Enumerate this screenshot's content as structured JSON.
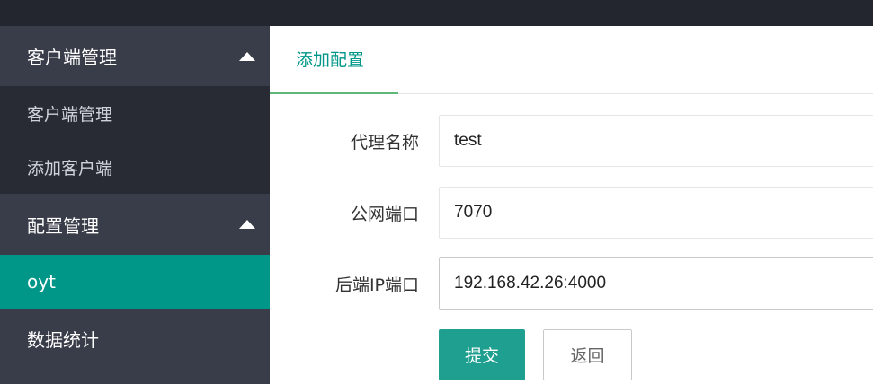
{
  "sidebar": {
    "groups": [
      {
        "label": "客户端管理",
        "expanded": true,
        "items": [
          {
            "label": "客户端管理"
          },
          {
            "label": "添加客户端"
          }
        ]
      },
      {
        "label": "配置管理",
        "expanded": true,
        "items": [
          {
            "label": "oyt",
            "active": true
          }
        ]
      },
      {
        "label": "数据统计"
      }
    ]
  },
  "main": {
    "tab": {
      "label": "添加配置"
    },
    "form": {
      "proxy_name": {
        "label": "代理名称",
        "value": "test"
      },
      "public_port": {
        "label": "公网端口",
        "value": "7070"
      },
      "backend": {
        "label": "后端IP端口",
        "value": "192.168.42.26:4000"
      }
    },
    "buttons": {
      "submit": "提交",
      "back": "返回"
    }
  },
  "colors": {
    "topbar": "#23262e",
    "sidebar": "#393d49",
    "submenu": "#282b33",
    "accent": "#009688",
    "tab_underline": "#5fb878"
  }
}
